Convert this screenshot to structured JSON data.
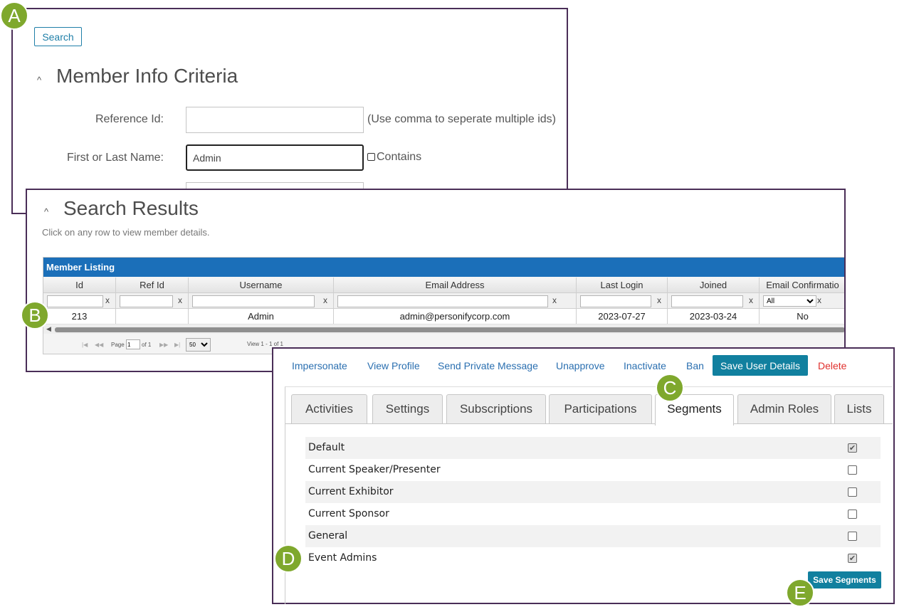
{
  "badges": {
    "a": "A",
    "b": "B",
    "c": "C",
    "d": "D",
    "e": "E"
  },
  "member_info": {
    "search_label": "Search",
    "title": "Member Info Criteria",
    "collapse_glyph": "^",
    "reference_id_label": "Reference Id:",
    "reference_id_value": "",
    "reference_id_hint": "(Use comma to seperate multiple ids)",
    "name_label": "First or Last Name:",
    "name_value": "Admin",
    "contains_label": "Contains"
  },
  "search_results": {
    "title": "Search Results",
    "collapse_glyph": "^",
    "subtitle": "Click on any row to view member details.",
    "grid": {
      "title": "Member Listing",
      "columns": [
        "Id",
        "Ref Id",
        "Username",
        "Email Address",
        "Last Login",
        "Joined",
        "Email Confirmatio"
      ],
      "filter_clear": "x",
      "email_confirm_filter": "All",
      "rows": [
        {
          "id": "213",
          "ref_id": "",
          "username": "Admin",
          "email": "admin@personifycorp.com",
          "last_login": "2023-07-27",
          "joined": "2023-03-24",
          "email_confirmed": "No"
        }
      ],
      "pager": {
        "page_label": "Page",
        "page_value": "1",
        "of_label": "of 1",
        "page_size": "50",
        "view_text": "View 1 - 1 of 1"
      }
    }
  },
  "member_details": {
    "actions": {
      "impersonate": "Impersonate",
      "view_profile": "View Profile",
      "send_private_message": "Send Private Message",
      "unapprove": "Unapprove",
      "inactivate": "Inactivate",
      "ban": "Ban",
      "save_user_details": "Save User Details",
      "delete": "Delete"
    },
    "tabs": [
      {
        "label": "Activities",
        "active": false
      },
      {
        "label": "Settings",
        "active": false
      },
      {
        "label": "Subscriptions",
        "active": false
      },
      {
        "label": "Participations",
        "active": false
      },
      {
        "label": "Segments",
        "active": true
      },
      {
        "label": "Admin Roles",
        "active": false
      },
      {
        "label": "Lists",
        "active": false
      }
    ],
    "segments": [
      {
        "label": "Default",
        "checked": true
      },
      {
        "label": "Current Speaker/Presenter",
        "checked": false
      },
      {
        "label": "Current Exhibitor",
        "checked": false
      },
      {
        "label": "Current Sponsor",
        "checked": false
      },
      {
        "label": "General",
        "checked": false
      },
      {
        "label": "Event Admins",
        "checked": true
      }
    ],
    "save_segments": "Save Segments"
  },
  "colors": {
    "panel_border": "#4a2e57",
    "badge": "#7fa82d",
    "primary_button": "#11809f",
    "grid_header": "#1b6fb9",
    "link": "#2a6fb0",
    "danger": "#e0302d"
  }
}
